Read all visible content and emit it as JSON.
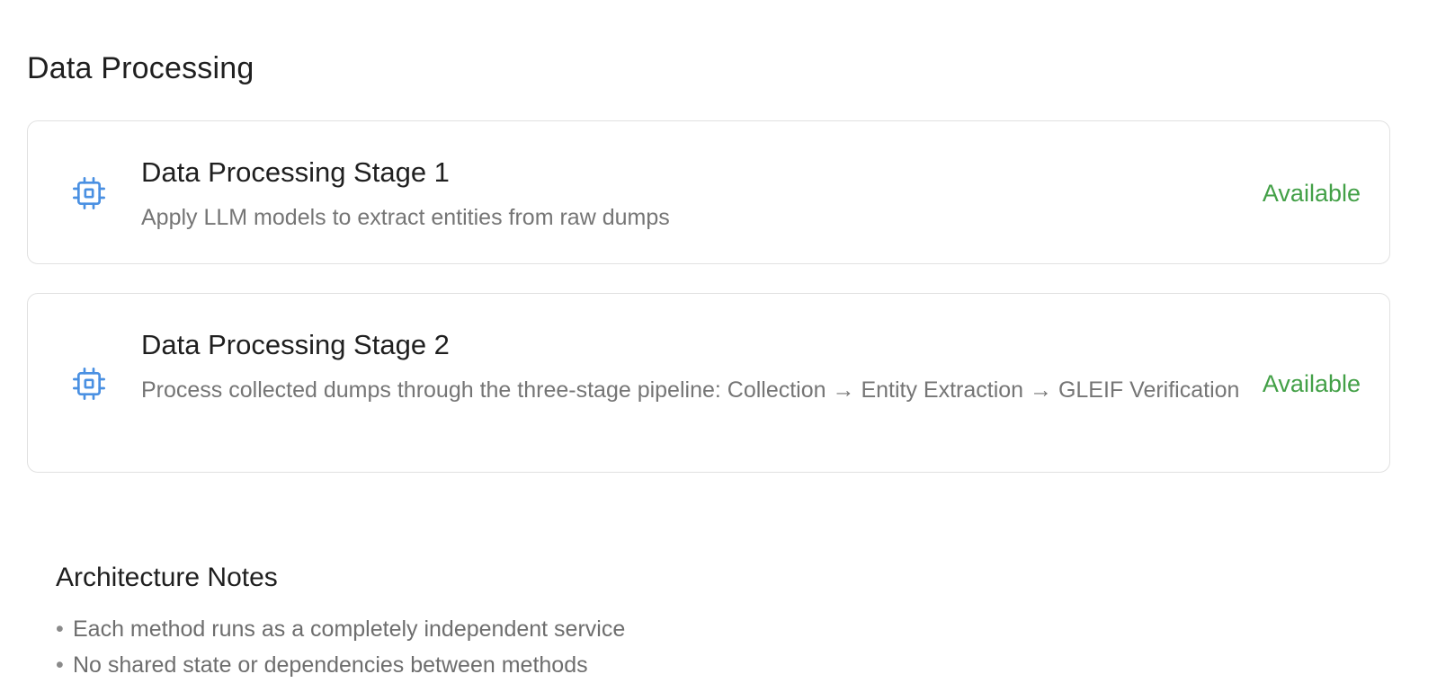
{
  "section": {
    "title": "Data Processing"
  },
  "cards": [
    {
      "icon": "cpu-chip-icon",
      "title": "Data Processing Stage 1",
      "description": "Apply LLM models to extract entities from raw dumps",
      "status": "Available"
    },
    {
      "icon": "cpu-chip-icon",
      "title": "Data Processing Stage 2",
      "description": "Process collected dumps through the three-stage pipeline: Collection → Entity Extraction → GLEIF Verification",
      "status": "Available"
    }
  ],
  "notes": {
    "title": "Architecture Notes",
    "bullet": "•",
    "items": [
      "Each method runs as a completely independent service",
      "No shared state or dependencies between methods"
    ]
  },
  "colors": {
    "icon": "#4a90e2",
    "status_available": "#43a047",
    "card_border": "#e1e1e1",
    "muted_text": "#757575"
  }
}
